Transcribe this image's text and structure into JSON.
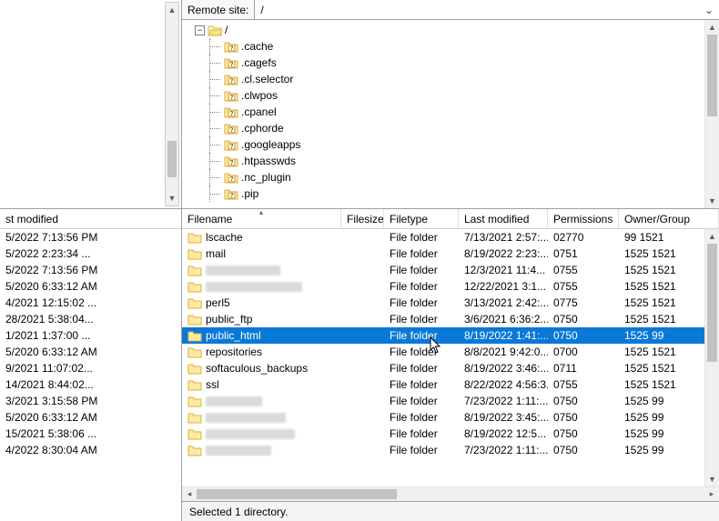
{
  "left": {
    "header": "st modified",
    "rows": [
      "5/2022 7:13:56 PM",
      "5/2022 2:23:34 ...",
      "5/2022 7:13:56 PM",
      "5/2020 6:33:12 AM",
      "4/2021 12:15:02 ...",
      "28/2021 5:38:04...",
      "1/2021 1:37:00 ...",
      "5/2020 6:33:12 AM",
      "9/2021 11:07:02...",
      "14/2021 8:44:02...",
      "3/2021 3:15:58 PM",
      "5/2020 6:33:12 AM",
      "15/2021 5:38:06 ...",
      "4/2022 8:30:04 AM"
    ]
  },
  "remote": {
    "label": "Remote site:",
    "path": "/",
    "tree_root": "/",
    "tree": [
      ".cache",
      ".cagefs",
      ".cl.selector",
      ".clwpos",
      ".cpanel",
      ".cphorde",
      ".googleapps",
      ".htpasswds",
      ".nc_plugin",
      ".pip"
    ]
  },
  "columns": {
    "name": "Filename",
    "size": "Filesize",
    "type": "Filetype",
    "mod": "Last modified",
    "perm": "Permissions",
    "own": "Owner/Group"
  },
  "files": [
    {
      "name": "lscache",
      "type": "File folder",
      "mod": "7/13/2021 2:57:...",
      "perm": "02770",
      "own": "99 1521"
    },
    {
      "name": "mail",
      "type": "File folder",
      "mod": "8/19/2022 2:23:...",
      "perm": "0751",
      "own": "1525 1521"
    },
    {
      "name": "",
      "blur": true,
      "blurw": 82,
      "type": "File folder",
      "mod": "12/3/2021 11:4...",
      "perm": "0755",
      "own": "1525 1521"
    },
    {
      "name": "",
      "blur": true,
      "blurw": 106,
      "type": "File folder",
      "mod": "12/22/2021 3:1...",
      "perm": "0755",
      "own": "1525 1521"
    },
    {
      "name": "perl5",
      "type": "File folder",
      "mod": "3/13/2021 2:42:...",
      "perm": "0775",
      "own": "1525 1521"
    },
    {
      "name": "public_ftp",
      "type": "File folder",
      "mod": "3/6/2021 6:36:2...",
      "perm": "0750",
      "own": "1525 1521"
    },
    {
      "name": "public_html",
      "type": "File folder",
      "mod": "8/19/2022 1:41:...",
      "perm": "0750",
      "own": "1525 99",
      "selected": true
    },
    {
      "name": "repositories",
      "type": "File folder",
      "mod": "8/8/2021 9:42:0...",
      "perm": "0700",
      "own": "1525 1521"
    },
    {
      "name": "softaculous_backups",
      "type": "File folder",
      "mod": "8/19/2022 3:46:...",
      "perm": "0711",
      "own": "1525 1521"
    },
    {
      "name": "ssl",
      "type": "File folder",
      "mod": "8/22/2022 4:56:3...",
      "perm": "0755",
      "own": "1525 1521"
    },
    {
      "name": "",
      "blur": true,
      "blurw": 62,
      "type": "File folder",
      "mod": "7/23/2022 1:11:...",
      "perm": "0750",
      "own": "1525 99"
    },
    {
      "name": "",
      "blur": true,
      "blurw": 88,
      "type": "File folder",
      "mod": "8/19/2022 3:45:...",
      "perm": "0750",
      "own": "1525 99"
    },
    {
      "name": "",
      "blur": true,
      "blurw": 98,
      "type": "File folder",
      "mod": "8/19/2022 12:5...",
      "perm": "0750",
      "own": "1525 99"
    },
    {
      "name": "",
      "blur": true,
      "blurw": 72,
      "type": "File folder",
      "mod": "7/23/2022 1:11:...",
      "perm": "0750",
      "own": "1525 99"
    }
  ],
  "status": "Selected 1 directory."
}
